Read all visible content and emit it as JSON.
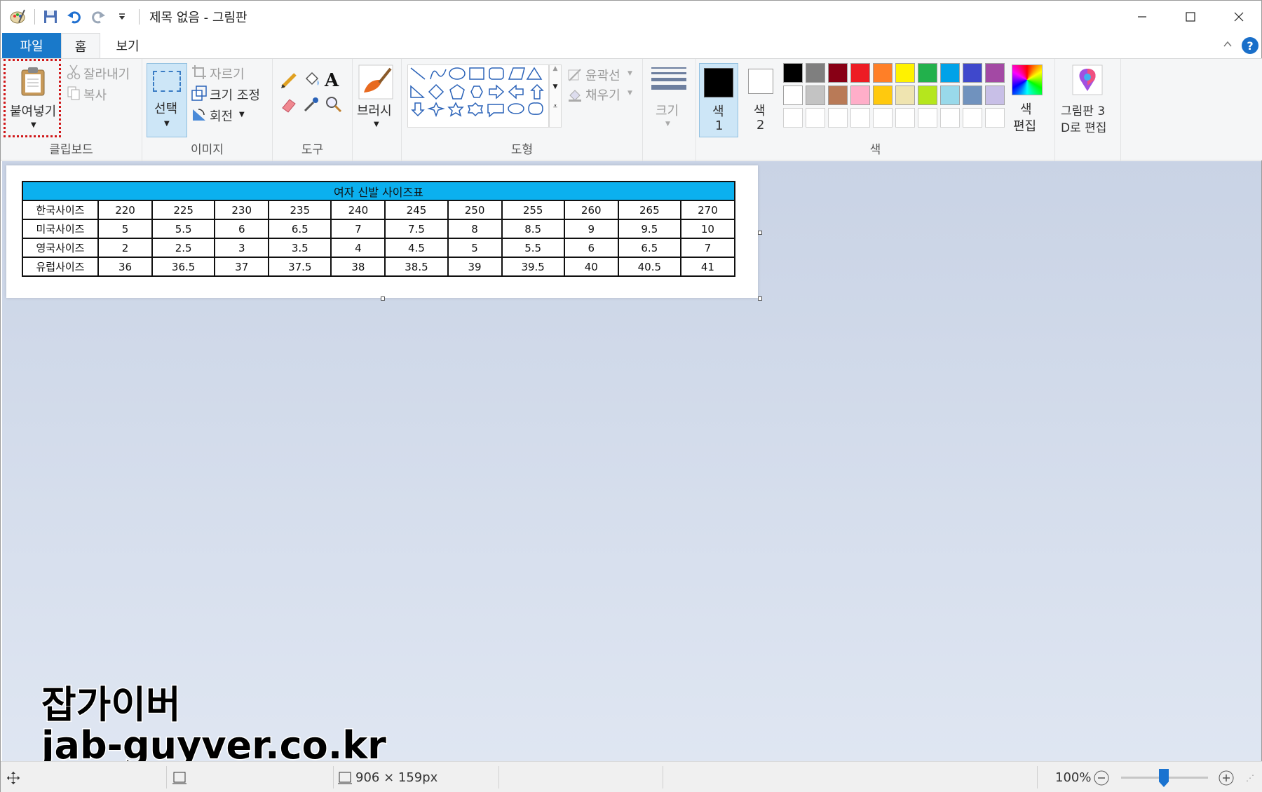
{
  "window": {
    "title": "제목 없음 - 그림판",
    "controls": {
      "minimize": "─",
      "maximize": "☐",
      "close": "✕"
    }
  },
  "tabs": {
    "file": "파일",
    "home": "홈",
    "view": "보기",
    "help": "?"
  },
  "ribbon": {
    "clipboard": {
      "paste": "붙여넣기",
      "cut": "잘라내기",
      "copy": "복사",
      "label": "클립보드"
    },
    "image": {
      "select": "선택",
      "crop": "자르기",
      "resize": "크기 조정",
      "rotate": "회전",
      "label": "이미지"
    },
    "tools": {
      "label": "도구"
    },
    "brushes": {
      "label": "브러시"
    },
    "shapes": {
      "outline": "윤곽선",
      "fill": "채우기",
      "label": "도형"
    },
    "size": {
      "label": "크기"
    },
    "colors": {
      "color1_line1": "색",
      "color1_line2": "1",
      "color2_line1": "색",
      "color2_line2": "2",
      "edit_line1": "색",
      "edit_line2": "편집",
      "paint3d_line1": "그림판 3",
      "paint3d_line2": "D로 편집",
      "label": "색",
      "palette_row1": [
        "#000000",
        "#7f7f7f",
        "#880015",
        "#ed1c24",
        "#ff7f27",
        "#fff200",
        "#22b14c",
        "#00a2e8",
        "#3f48cc",
        "#a349a4"
      ],
      "palette_row2": [
        "#ffffff",
        "#c3c3c3",
        "#b97a57",
        "#ffaec9",
        "#ffc90e",
        "#efe4b0",
        "#b5e61d",
        "#99d9ea",
        "#7092be",
        "#c8bfe7"
      ]
    }
  },
  "size_table": {
    "title": "여자 신발 사이즈표",
    "rows": [
      {
        "label": "한국사이즈",
        "values": [
          "220",
          "225",
          "230",
          "235",
          "240",
          "245",
          "250",
          "255",
          "260",
          "265",
          "270"
        ]
      },
      {
        "label": "미국사이즈",
        "values": [
          "5",
          "5.5",
          "6",
          "6.5",
          "7",
          "7.5",
          "8",
          "8.5",
          "9",
          "9.5",
          "10"
        ]
      },
      {
        "label": "영국사이즈",
        "values": [
          "2",
          "2.5",
          "3",
          "3.5",
          "4",
          "4.5",
          "5",
          "5.5",
          "6",
          "6.5",
          "7"
        ]
      },
      {
        "label": "유럽사이즈",
        "values": [
          "36",
          "36.5",
          "37",
          "37.5",
          "38",
          "38.5",
          "39",
          "39.5",
          "40",
          "40.5",
          "41"
        ]
      }
    ]
  },
  "watermark": {
    "line1": "잡가이버",
    "line2": "jab-guyver.co.kr"
  },
  "statusbar": {
    "image_size": "906 × 159px",
    "zoom": "100%"
  }
}
